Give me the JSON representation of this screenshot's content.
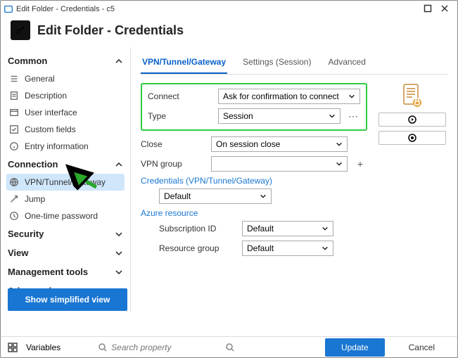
{
  "titlebar": {
    "text": "Edit Folder - Credentials - c5"
  },
  "header": {
    "title": "Edit Folder - Credentials"
  },
  "sidebar": {
    "sections": [
      {
        "label": "Common",
        "expanded": true,
        "items": [
          {
            "label": "General",
            "icon": "list-icon"
          },
          {
            "label": "Description",
            "icon": "doc-icon"
          },
          {
            "label": "User interface",
            "icon": "window-icon"
          },
          {
            "label": "Custom fields",
            "icon": "check-icon"
          },
          {
            "label": "Entry information",
            "icon": "info-icon"
          }
        ]
      },
      {
        "label": "Connection",
        "expanded": true,
        "items": [
          {
            "label": "VPN/Tunnel/Gateway",
            "icon": "globe-icon",
            "selected": true
          },
          {
            "label": "Jump",
            "icon": "jump-icon"
          },
          {
            "label": "One-time password",
            "icon": "clock-icon"
          }
        ]
      },
      {
        "label": "Security",
        "expanded": false
      },
      {
        "label": "View",
        "expanded": false
      },
      {
        "label": "Management tools",
        "expanded": false
      },
      {
        "label": "Advanced",
        "expanded": false
      }
    ],
    "simplified_btn": "Show simplified view"
  },
  "main": {
    "tabs": [
      "VPN/Tunnel/Gateway",
      "Settings (Session)",
      "Advanced"
    ],
    "active_tab": 0,
    "form": {
      "connect_label": "Connect",
      "connect_value": "Ask for confirmation to connect",
      "type_label": "Type",
      "type_value": "Session",
      "close_label": "Close",
      "close_value": "On session close",
      "vpngroup_label": "VPN group",
      "vpngroup_value": "",
      "creds_link": "Credentials (VPN/Tunnel/Gateway)",
      "creds_value": "Default",
      "az_link": "Azure resource",
      "subid_label": "Subscription ID",
      "subid_value": "Default",
      "rg_label": "Resource group",
      "rg_value": "Default"
    }
  },
  "footer": {
    "variables": "Variables",
    "search_placeholder": "Search property",
    "update": "Update",
    "cancel": "Cancel"
  }
}
